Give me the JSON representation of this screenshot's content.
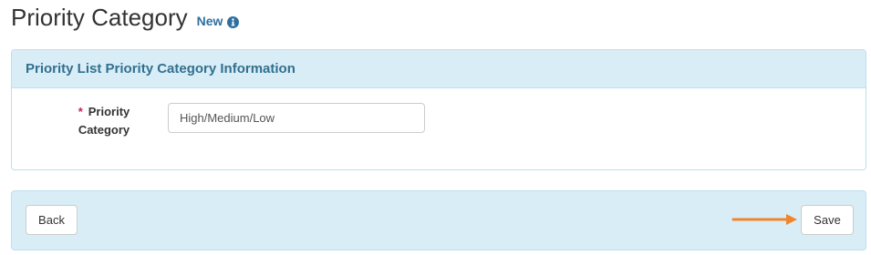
{
  "header": {
    "title": "Priority Category",
    "badge": "New",
    "info_icon": "info-circle-icon"
  },
  "panel": {
    "title": "Priority List Priority Category Information"
  },
  "form": {
    "required_marker": "*",
    "label_line1": "Priority",
    "label_line2": "Category",
    "value": "High/Medium/Low"
  },
  "footer": {
    "back_label": "Back",
    "save_label": "Save",
    "arrow_icon": "right-arrow-icon",
    "arrow_color": "#f0852d"
  },
  "colors": {
    "panel_bg": "#d9edf7",
    "panel_border": "#bce0ee",
    "panel_title": "#31708f",
    "badge": "#2f6f9f",
    "required": "#c7254e"
  }
}
